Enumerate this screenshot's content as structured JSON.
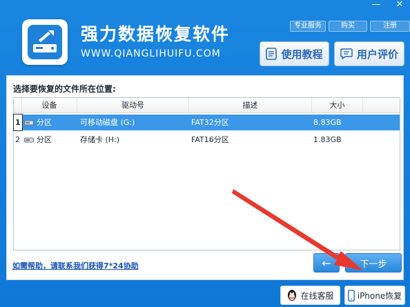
{
  "app": {
    "title": "强力数据恢复软件",
    "url": "WWW.QIANGLIHUIFU.COM"
  },
  "window_controls": {
    "minimize": "—",
    "close": "✕"
  },
  "top_links": [
    {
      "label": "专业服务"
    },
    {
      "label": "购买"
    },
    {
      "label": "注册"
    }
  ],
  "header_buttons": {
    "tutorial": "使用教程",
    "review": "用户评价"
  },
  "main": {
    "prompt": "选择要恢复的文件所在位置:",
    "columns": [
      "设备",
      "驱动号",
      "描述",
      "大小"
    ],
    "rows": [
      {
        "index": "1",
        "device": "分区",
        "drive": "可移动磁盘 (G:)",
        "desc": "FAT32分区",
        "size": "8.83GB",
        "selected": true
      },
      {
        "index": "2",
        "device": "分区",
        "drive": "存储卡 (H:)",
        "desc": "FAT16分区",
        "size": "1.83GB",
        "selected": false
      }
    ],
    "help_link": "如需帮助，请联系我们获得7*24协助",
    "back_icon": "←",
    "next_label": "下一步"
  },
  "footer": {
    "customer_service": "在线客服",
    "iphone_recovery": "iPhone恢复"
  },
  "colors": {
    "accent": "#1a86e0",
    "selection": "#3b97e8",
    "arrow": "#e8382f"
  }
}
